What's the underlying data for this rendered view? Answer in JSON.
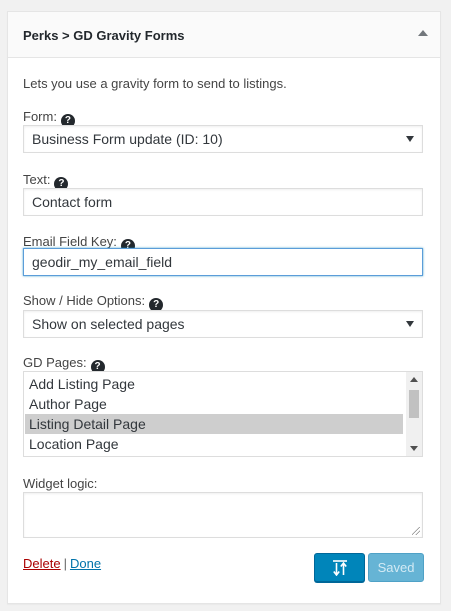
{
  "widget": {
    "title": "Perks > GD Gravity Forms",
    "description": "Lets you use a gravity form to send to listings."
  },
  "form_field": {
    "label": "Form:",
    "value": "Business Form update (ID: 10)"
  },
  "text_field": {
    "label": "Text:",
    "value": "Contact form"
  },
  "email_field": {
    "label": "Email Field Key:",
    "value": "geodir_my_email_field"
  },
  "show_hide": {
    "label": "Show / Hide Options:",
    "value": "Show on selected pages"
  },
  "gd_pages": {
    "label": "GD Pages:",
    "items": [
      {
        "label": "Add Listing Page",
        "selected": false
      },
      {
        "label": "Author Page",
        "selected": false
      },
      {
        "label": "Listing Detail Page",
        "selected": true
      },
      {
        "label": "Location Page",
        "selected": false
      }
    ]
  },
  "widget_logic": {
    "label": "Widget logic:",
    "value": ""
  },
  "actions": {
    "delete_label": "Delete",
    "separator": "|",
    "done_label": "Done",
    "saved_label": "Saved"
  },
  "help_icon_glyph": "?",
  "colors": {
    "primary_button": "#0085ba",
    "saved_button": "#66b4d5",
    "delete_link": "#a00",
    "done_link": "#0073aa",
    "selected_item": "#cecece"
  }
}
